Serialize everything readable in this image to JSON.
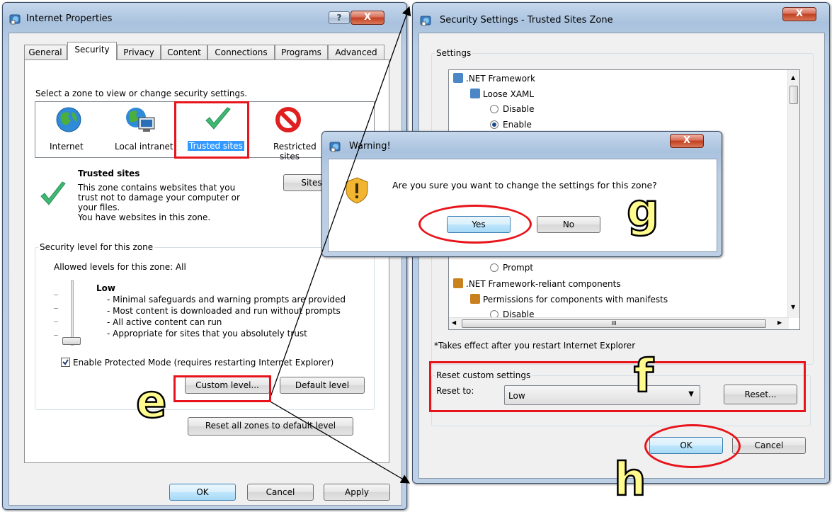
{
  "internet_properties": {
    "title": "Internet Properties",
    "help_btn": "?",
    "close_btn": "X",
    "tabs": [
      "General",
      "Security",
      "Privacy",
      "Content",
      "Connections",
      "Programs",
      "Advanced"
    ],
    "zone_prompt": "Select a zone to view or change security settings.",
    "zones": [
      "Internet",
      "Local intranet",
      "Trusted sites",
      "Restricted sites"
    ],
    "zone_title": "Trusted sites",
    "zone_desc_1": "This zone contains websites that you",
    "zone_desc_2": "trust not to damage your computer or",
    "zone_desc_3": "your files.",
    "zone_desc_4": "You have websites in this zone.",
    "sites_btn": "Sites",
    "level_group": "Security level for this zone",
    "allowed": "Allowed levels for this zone: All",
    "level_name": "Low",
    "level_items": [
      "- Minimal safeguards and warning prompts are provided",
      "- Most content is downloaded and run without prompts",
      "- All active content can run",
      "- Appropriate for sites that you absolutely trust"
    ],
    "protected_mode": "Enable Protected Mode (requires restarting Internet Explorer)",
    "custom_level": "Custom level...",
    "default_level": "Default level",
    "reset_all": "Reset all zones to default level",
    "ok": "OK",
    "cancel": "Cancel",
    "apply": "Apply"
  },
  "security_settings": {
    "title": "Security Settings - Trusted Sites Zone",
    "close_btn": "X",
    "settings_label": "Settings",
    "tree": [
      ".NET Framework",
      "Loose XAML",
      "Disable",
      "Enable",
      "Prompt",
      ".NET Framework-reliant components",
      "Permissions for components with manifests",
      "Disable"
    ],
    "scroll_mid": "III",
    "note": "*Takes effect after you restart Internet Explorer",
    "reset_group": "Reset custom settings",
    "reset_to": "Reset to:",
    "reset_value": "Low",
    "reset_btn": "Reset...",
    "ok": "OK",
    "cancel": "Cancel"
  },
  "warning": {
    "title": "Warning!",
    "close_btn": "X",
    "message": "Are you sure you want to change the settings for this zone?",
    "yes": "Yes",
    "no": "No"
  },
  "annotations": {
    "e": "e",
    "f": "f",
    "g": "g",
    "h": "h"
  },
  "colors": {
    "annotation_red": "#e8141b",
    "annotation_letter": "#fffb8c",
    "selection_blue": "#3399ff"
  }
}
